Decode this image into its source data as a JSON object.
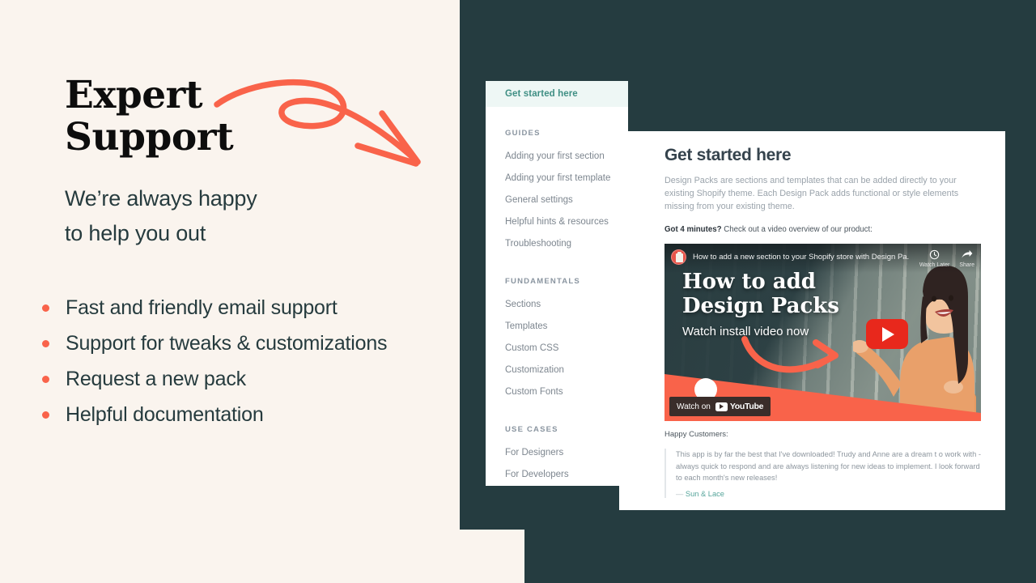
{
  "colors": {
    "cream": "#faf4ee",
    "dark_teal": "#253c40",
    "coral": "#f9634a",
    "accent_teal": "#3f8f84",
    "body_text": "#263b3e"
  },
  "left": {
    "headline_line1": "Expert",
    "headline_line2": "Support",
    "subhead_line1": "We’re always happy",
    "subhead_line2": "to help you out",
    "arrow_icon": "curly-arrow-icon",
    "bullets": [
      "Fast and friendly email support",
      "Support for tweaks & customizations",
      "Request a new pack",
      "Helpful documentation"
    ]
  },
  "sidebar": {
    "active_item": "Get started here",
    "groups": [
      {
        "title": "GUIDES",
        "items": [
          "Adding your first section",
          "Adding your first template",
          "General settings",
          "Helpful hints & resources",
          "Troubleshooting"
        ]
      },
      {
        "title": "FUNDAMENTALS",
        "items": [
          "Sections",
          "Templates",
          "Custom CSS",
          "Customization",
          "Custom Fonts"
        ]
      },
      {
        "title": "USE CASES",
        "items": [
          "For Designers",
          "For Developers"
        ]
      }
    ]
  },
  "main": {
    "title": "Get started here",
    "paragraph": "Design Packs are sections and templates that can be added directly to your existing Shopify theme.  Each Design Pack adds functional or style elements missing from your existing theme.",
    "cta_bold": "Got 4 minutes?",
    "cta_rest": " Check out a video overview of our product:",
    "video": {
      "channel_avatar_icon": "channel-avatar-icon",
      "title": "How to add a new section to your Shopify store with Design Pa...",
      "watch_later_label": "Watch Later",
      "watch_later_icon": "clock-icon",
      "share_label": "Share",
      "share_icon": "share-arrow-icon",
      "overlay_line1": "How to add",
      "overlay_line2": "Design Packs",
      "overlay_sub": "Watch install video now",
      "play_icon": "youtube-play-icon",
      "badge_watch_on": "Watch on",
      "badge_brand": "YouTube"
    },
    "testimonial": {
      "label": "Happy Customers:",
      "text": "This app is by far the best that I've downloaded! Trudy and Anne are a dream t o work with - always quick to respond and are always listening for new ideas to implement. I look forward to each month's new releases!",
      "author_dash": "— ",
      "author": "Sun & Lace"
    }
  }
}
